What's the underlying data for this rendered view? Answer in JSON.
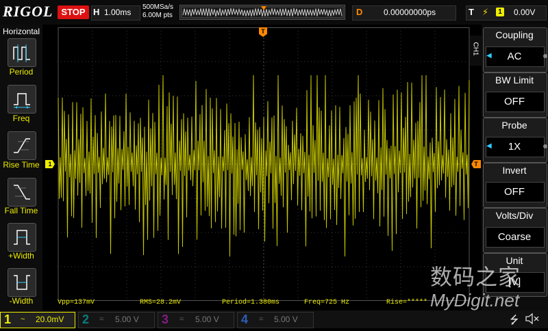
{
  "top": {
    "brand": "RIGOL",
    "run_state": "STOP",
    "horizontal": {
      "letter": "H",
      "timebase": "1.00ms",
      "sample_rate": "500MSa/s",
      "memory": "6.00M pts"
    },
    "delay": {
      "letter": "D",
      "value": "0.00000000ps"
    },
    "trigger": {
      "letter": "T",
      "edge_icon": "rising-edge-icon",
      "source": "1",
      "level": "0.00V"
    }
  },
  "left_menu": {
    "title": "Horizontal",
    "items": [
      {
        "label": "Period",
        "icon": "period-icon"
      },
      {
        "label": "Freq",
        "icon": "frequency-icon"
      },
      {
        "label": "Rise Time",
        "icon": "rise-time-icon"
      },
      {
        "label": "Fall Time",
        "icon": "fall-time-icon"
      },
      {
        "label": "+Width",
        "icon": "positive-width-icon"
      },
      {
        "label": "-Width",
        "icon": "negative-width-icon"
      }
    ]
  },
  "markers": {
    "ch1": "1",
    "trigger": "T"
  },
  "measurements": {
    "vpp": "Vpp=137mV",
    "rms": "RMS=28.2mV",
    "period": "Period=1.380ms",
    "freq": "Freq=725 Hz",
    "rise": "Rise=*****"
  },
  "right_menu": {
    "channel_tab": "CH1",
    "items": [
      {
        "title": "Coupling",
        "value": "AC"
      },
      {
        "title": "BW Limit",
        "value": "OFF"
      },
      {
        "title": "Probe",
        "value": "1X"
      },
      {
        "title": "Invert",
        "value": "OFF"
      },
      {
        "title": "Volts/Div",
        "value": "Coarse"
      },
      {
        "title": "Unit",
        "value": "[V]"
      }
    ]
  },
  "bottom": {
    "channels": [
      {
        "num": "1",
        "coupling": "~",
        "scale": "20.0mV",
        "color": "#eeee00"
      },
      {
        "num": "2",
        "coupling": "=",
        "scale": "5.00 V",
        "color": "#00bfbf"
      },
      {
        "num": "3",
        "coupling": "=",
        "scale": "5.00 V",
        "color": "#d020d0"
      },
      {
        "num": "4",
        "coupling": "=",
        "scale": "5.00 V",
        "color": "#3a7bff"
      }
    ],
    "icons": [
      "usb-icon",
      "speaker-muted-icon"
    ]
  },
  "watermark": {
    "line1": "数码之家",
    "line2": "MyDigit.net"
  },
  "colors": {
    "ch1": "#d6d600",
    "trigger": "#ff8800",
    "stop": "#dd1111",
    "accent": "#33ccff"
  }
}
